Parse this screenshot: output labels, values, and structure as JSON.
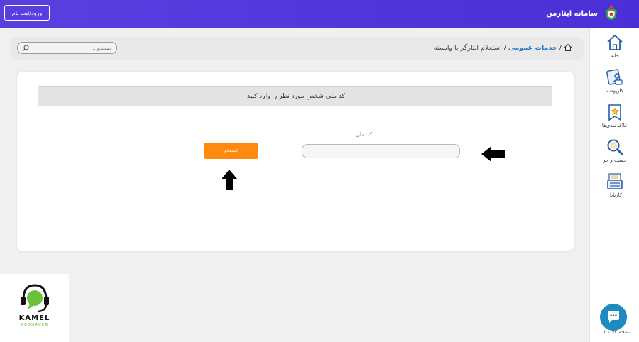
{
  "header": {
    "app_title": "سامانه ایثارمن",
    "login_label": "ورود/ثبت نام"
  },
  "colors": {
    "header_bg": "#4f35dc",
    "accent_orange": "#ff8a0d",
    "link_blue": "#2a7ec7",
    "chat_blue": "#1f8ac0",
    "sidebar_icon_blue": "#2a5ea8"
  },
  "search": {
    "placeholder": "جستجو..."
  },
  "breadcrumb": {
    "home_icon": "home-icon",
    "link_label": "خدمات عمومی",
    "separator": "/",
    "current": "استعلام ایثارگر یا وابسته"
  },
  "form": {
    "notice": "کد ملی شخص مورد نظر را وارد کنید.",
    "field_label": "کد ملی",
    "field_value": "",
    "submit_label": "استعلام"
  },
  "sidebar": {
    "items": [
      {
        "label": "خانه",
        "icon": "home-icon"
      },
      {
        "label": "کارپوشه",
        "icon": "folder-user-icon"
      },
      {
        "label": "علاقه‌مندی‌ها",
        "icon": "star-bookmark-icon"
      },
      {
        "label": "جست و جو",
        "icon": "magnifier-icon"
      },
      {
        "label": "کارتابل",
        "icon": "inbox-tray-icon"
      }
    ],
    "version": "نسخه ۱.۰.۷۲"
  },
  "watermark": {
    "name": "KAMEL",
    "sub": "MOSHAVER"
  }
}
